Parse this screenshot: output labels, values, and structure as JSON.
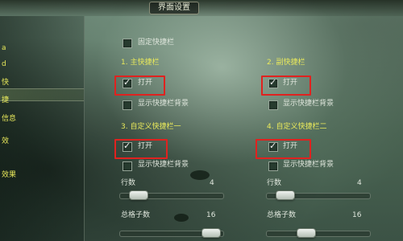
{
  "window": {
    "title": "界面设置"
  },
  "sidebar": {
    "items": [
      "a",
      "d",
      "快",
      "捷",
      "信息",
      "效",
      "效果"
    ]
  },
  "main": {
    "fixed_shortcut_bar": "固定快捷栏",
    "sections": [
      {
        "title": "1. 主快捷栏",
        "open_label": "打开",
        "background_label": "显示快捷栏背景",
        "open_checked": true
      },
      {
        "title": "2. 副快捷栏",
        "open_label": "打开",
        "background_label": "显示快捷栏背景",
        "open_checked": true
      },
      {
        "title": "3. 自定义快捷栏一",
        "open_label": "打开",
        "background_label": "显示快捷栏背景",
        "open_checked": true
      },
      {
        "title": "4. 自定义快捷栏二",
        "open_label": "打开",
        "background_label": "显示快捷栏背景",
        "open_checked": true
      }
    ],
    "sliders": [
      {
        "label": "行数",
        "value": "4",
        "level_percent": 10
      },
      {
        "label": "总格子数",
        "value": "16",
        "level_percent": 95
      },
      {
        "label": "行数",
        "value": "4",
        "level_percent": 10
      },
      {
        "label": "总格子数",
        "value": "16",
        "level_percent": 35
      }
    ]
  },
  "colors": {
    "accent_red": "#e0221f",
    "accent_yellow": "#e9e95b"
  },
  "icons": [
    "check-icon"
  ]
}
